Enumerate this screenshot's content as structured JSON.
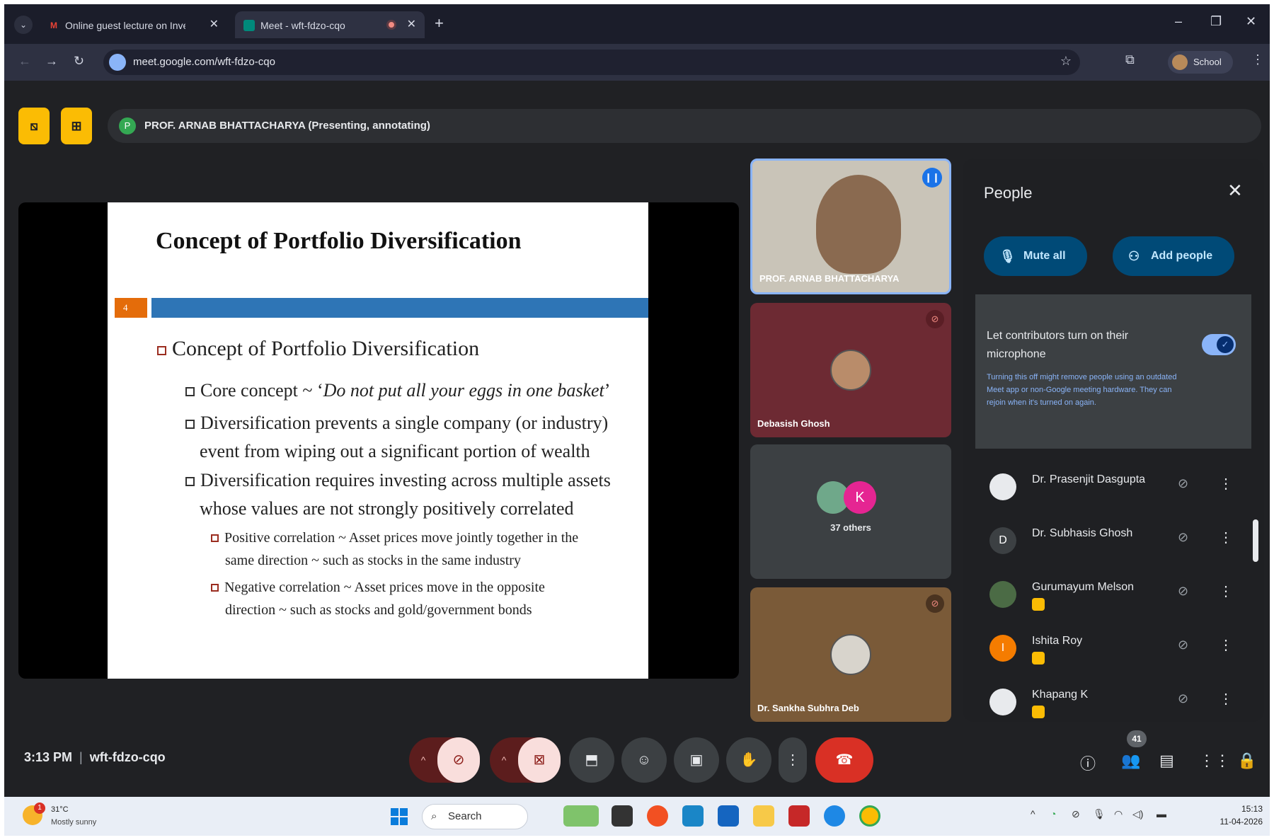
{
  "browser": {
    "tabs": [
      {
        "icon": "gmail-icon",
        "label": "Online guest lecture on Investi"
      },
      {
        "icon": "meet-icon",
        "label": "Meet - wft-fdzo-cqo"
      }
    ],
    "url": "meet.google.com/wft-fdzo-cqo",
    "profile_label": "School"
  },
  "meet": {
    "presenter_initial": "P",
    "presenter_banner": "PROF. ARNAB BHATTACHARYA (Presenting, annotating)",
    "slide": {
      "title": "Concept of Portfolio Diversification",
      "number": "4",
      "bullet1": "Concept of Portfolio Diversification",
      "bullet2_prefix": "Core concept ~ ‘",
      "bullet2_quote": "Do not put all your eggs in one basket",
      "bullet2_suffix": "’",
      "bullet3_line1": "Diversification prevents a single company (or industry)",
      "bullet3_line2": "event from wiping out a significant portion of wealth",
      "bullet4_line1": "Diversification requires investing across multiple assets",
      "bullet4_line2": "whose values are not strongly positively correlated",
      "bullet5_line1": "Positive correlation ~ Asset prices move jointly together in the",
      "bullet5_line2": "same direction ~ such as stocks in the same industry",
      "bullet6_line1": "Negative correlation ~ Asset prices move in the opposite",
      "bullet6_line2": "direction ~ such as stocks and gold/government bonds"
    },
    "tiles": [
      {
        "name": "PROF. ARNAB BHATTACHARYA"
      },
      {
        "name": "Debasish Ghosh"
      },
      {
        "name": "37 others",
        "avatar_letter": "K"
      },
      {
        "name": "Dr. Sankha Subhra Deb"
      }
    ],
    "time": "3:13 PM",
    "meeting_code": "wft-fdzo-cqo",
    "participant_count": "41"
  },
  "people": {
    "title": "People",
    "mute_all": "Mute all",
    "add_people": "Add people",
    "contrib_title": "Let contributors turn on their microphone",
    "contrib_note": "Turning this off might remove people using an outdated Meet app or non-Google meeting hardware. They can rejoin when it's turned on again.",
    "list": [
      {
        "name": "Dr. Prasenjit Dasgupta",
        "initial": ""
      },
      {
        "name": "Dr. Subhasis Ghosh",
        "initial": "D"
      },
      {
        "name": "Gurumayum Melson",
        "initial": ""
      },
      {
        "name": "Ishita Roy",
        "initial": "I"
      },
      {
        "name": "Khapang K",
        "initial": ""
      }
    ]
  },
  "taskbar": {
    "weather_badge": "1",
    "temp": "31°C",
    "condition": "Mostly sunny",
    "search": "Search",
    "time": "15:13",
    "date": "11-04-2026"
  },
  "colors": {
    "meet_bg": "#202124",
    "accent_blue": "#8ab4f8",
    "leave_red": "#d93025",
    "host_badge": "#fbbc04"
  }
}
